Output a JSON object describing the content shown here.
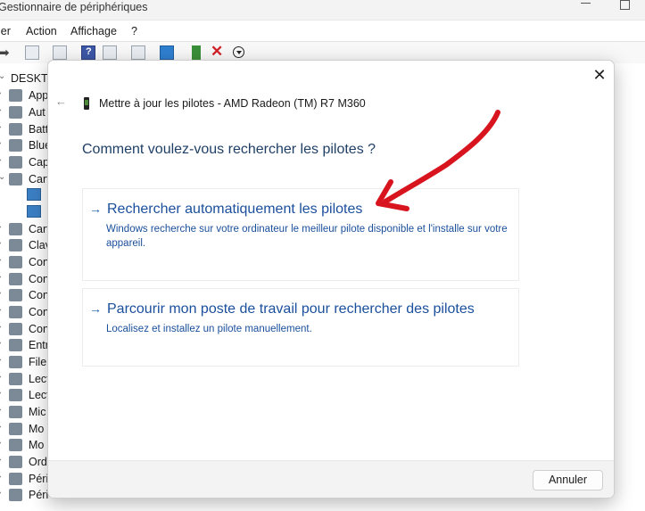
{
  "window": {
    "title": "Gestionnaire de périphériques"
  },
  "menu": {
    "items": [
      "ier",
      "Action",
      "Affichage",
      "?"
    ]
  },
  "tree": {
    "root": "DESKTO",
    "items": [
      "App",
      "Aut",
      "Batt",
      "Blue",
      "Cap",
      "Cart",
      "Cart",
      "Clav",
      "Con",
      "Con",
      "Con",
      "Con",
      "Con",
      "Entr",
      "File",
      "Lect",
      "Lect",
      "Mic",
      "Mo",
      "Mo",
      "Ord",
      "Péri",
      "Péri"
    ]
  },
  "dialog": {
    "header": "Mettre à jour les pilotes - AMD Radeon (TM) R7 M360",
    "question": "Comment voulez-vous rechercher les pilotes ?",
    "options": [
      {
        "title": "Rechercher automatiquement les pilotes",
        "description": "Windows recherche sur votre ordinateur le meilleur pilote disponible et l'installe sur votre appareil."
      },
      {
        "title": "Parcourir mon poste de travail pour rechercher des pilotes",
        "description": "Localisez et installez un pilote manuellement."
      }
    ],
    "cancel_label": "Annuler"
  },
  "icons": {
    "back": "back-arrow-icon",
    "close": "close-icon",
    "option_arrow": "arrow-right-icon",
    "device": "graphics-card-icon"
  },
  "colors": {
    "link_blue": "#1a4f9c",
    "question_blue": "#1f3f66",
    "annotation_red": "#d8141e"
  }
}
